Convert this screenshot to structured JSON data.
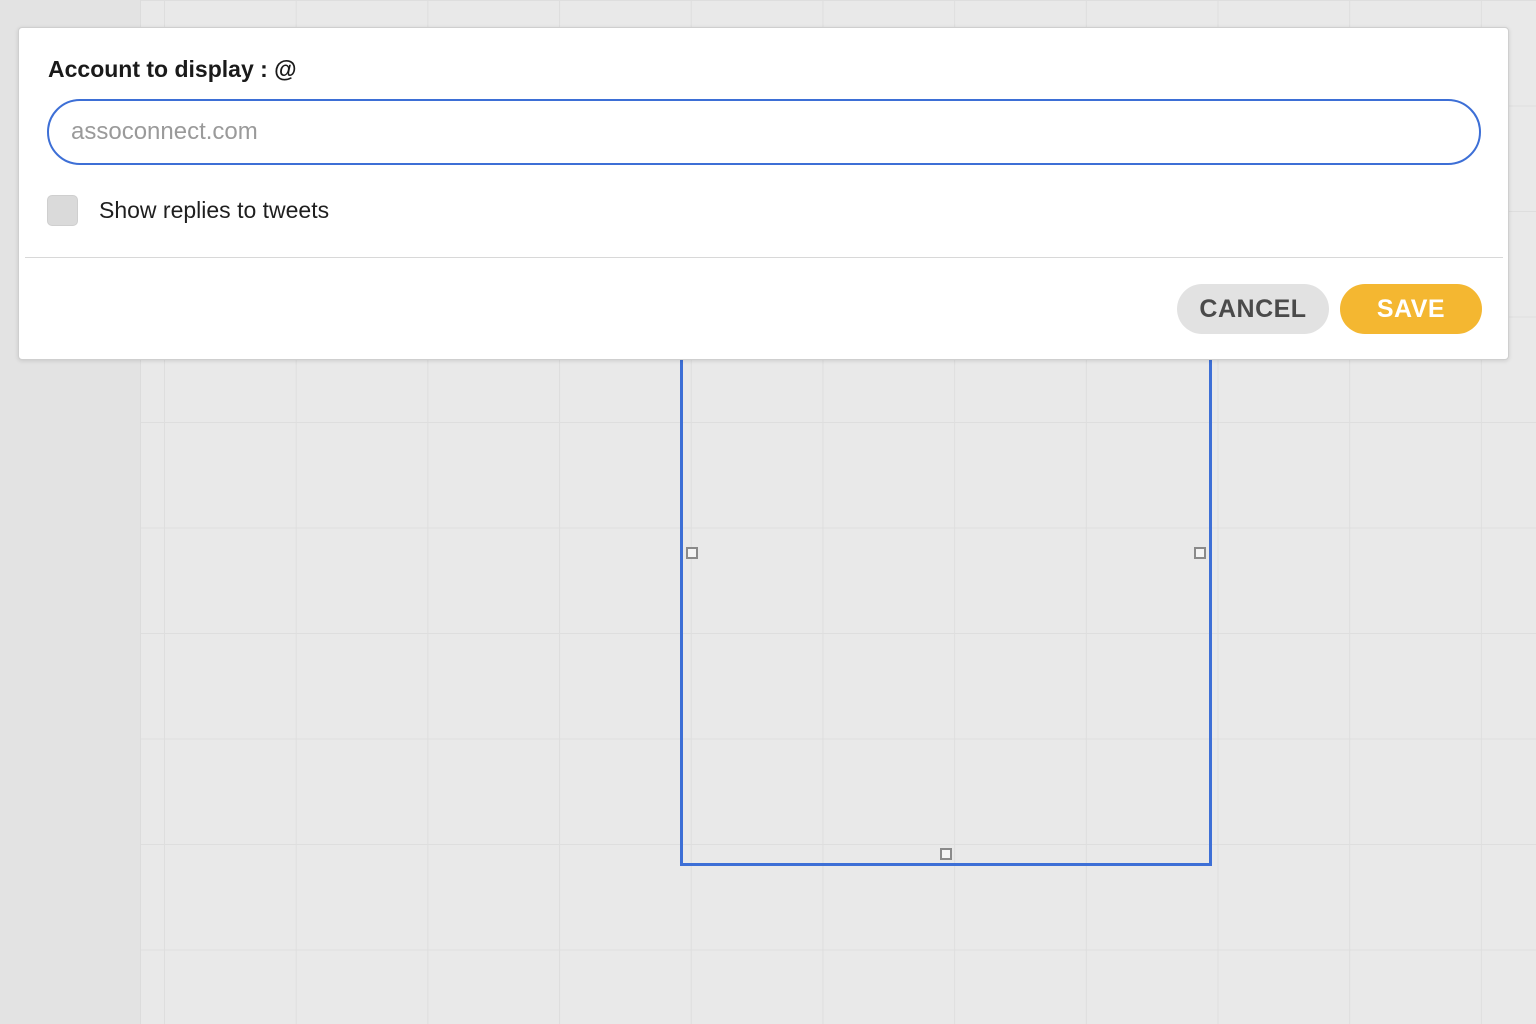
{
  "dialog": {
    "field_label": "Account to display : @",
    "account_input": {
      "value": "",
      "placeholder": "assoconnect.com"
    },
    "show_replies": {
      "label": "Show replies to tweets",
      "checked": false
    },
    "cancel_label": "CANCEL",
    "save_label": "SAVE"
  },
  "colors": {
    "accent": "#3d6fd6",
    "save_button": "#f4b731",
    "cancel_button": "#e2e2e2"
  }
}
